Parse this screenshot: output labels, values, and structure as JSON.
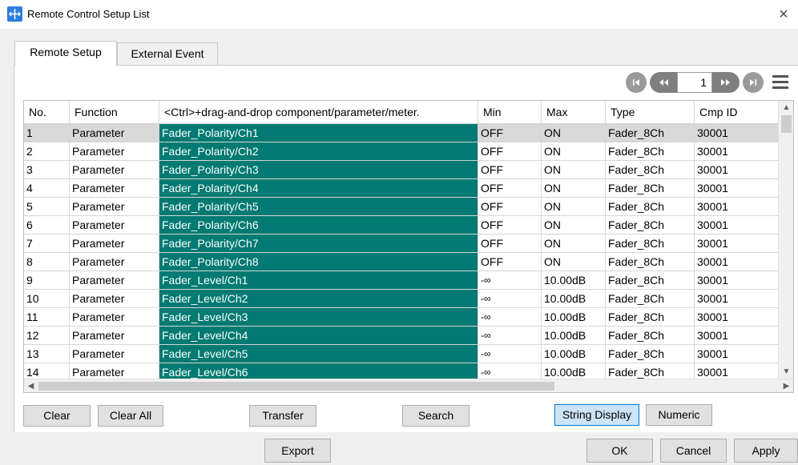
{
  "window": {
    "title": "Remote Control Setup List",
    "close_glyph": "×"
  },
  "tabs": [
    {
      "label": "Remote Setup",
      "active": true
    },
    {
      "label": "External Event",
      "active": false
    }
  ],
  "pager": {
    "first_glyph": "◀|",
    "prev_glyph": "◀◀",
    "page": "1",
    "next_glyph": "▶▶",
    "last_glyph": "▶|"
  },
  "table": {
    "columns": {
      "no": "No.",
      "function": "Function",
      "target": "<Ctrl>+drag-and-drop component/parameter/meter.",
      "min": "Min",
      "max": "Max",
      "type": "Type",
      "cmp_id": "Cmp ID"
    },
    "rows": [
      {
        "no": "1",
        "function": "Parameter",
        "target": "Fader_Polarity/Ch1",
        "min": "OFF",
        "max": "ON",
        "type": "Fader_8Ch",
        "cmp_id": "30001"
      },
      {
        "no": "2",
        "function": "Parameter",
        "target": "Fader_Polarity/Ch2",
        "min": "OFF",
        "max": "ON",
        "type": "Fader_8Ch",
        "cmp_id": "30001"
      },
      {
        "no": "3",
        "function": "Parameter",
        "target": "Fader_Polarity/Ch3",
        "min": "OFF",
        "max": "ON",
        "type": "Fader_8Ch",
        "cmp_id": "30001"
      },
      {
        "no": "4",
        "function": "Parameter",
        "target": "Fader_Polarity/Ch4",
        "min": "OFF",
        "max": "ON",
        "type": "Fader_8Ch",
        "cmp_id": "30001"
      },
      {
        "no": "5",
        "function": "Parameter",
        "target": "Fader_Polarity/Ch5",
        "min": "OFF",
        "max": "ON",
        "type": "Fader_8Ch",
        "cmp_id": "30001"
      },
      {
        "no": "6",
        "function": "Parameter",
        "target": "Fader_Polarity/Ch6",
        "min": "OFF",
        "max": "ON",
        "type": "Fader_8Ch",
        "cmp_id": "30001"
      },
      {
        "no": "7",
        "function": "Parameter",
        "target": "Fader_Polarity/Ch7",
        "min": "OFF",
        "max": "ON",
        "type": "Fader_8Ch",
        "cmp_id": "30001"
      },
      {
        "no": "8",
        "function": "Parameter",
        "target": "Fader_Polarity/Ch8",
        "min": "OFF",
        "max": "ON",
        "type": "Fader_8Ch",
        "cmp_id": "30001"
      },
      {
        "no": "9",
        "function": "Parameter",
        "target": "Fader_Level/Ch1",
        "min": "-∞",
        "max": "10.00dB",
        "type": "Fader_8Ch",
        "cmp_id": "30001"
      },
      {
        "no": "10",
        "function": "Parameter",
        "target": "Fader_Level/Ch2",
        "min": "-∞",
        "max": "10.00dB",
        "type": "Fader_8Ch",
        "cmp_id": "30001"
      },
      {
        "no": "11",
        "function": "Parameter",
        "target": "Fader_Level/Ch3",
        "min": "-∞",
        "max": "10.00dB",
        "type": "Fader_8Ch",
        "cmp_id": "30001"
      },
      {
        "no": "12",
        "function": "Parameter",
        "target": "Fader_Level/Ch4",
        "min": "-∞",
        "max": "10.00dB",
        "type": "Fader_8Ch",
        "cmp_id": "30001"
      },
      {
        "no": "13",
        "function": "Parameter",
        "target": "Fader_Level/Ch5",
        "min": "-∞",
        "max": "10.00dB",
        "type": "Fader_8Ch",
        "cmp_id": "30001"
      },
      {
        "no": "14",
        "function": "Parameter",
        "target": "Fader_Level/Ch6",
        "min": "-∞",
        "max": "10.00dB",
        "type": "Fader_8Ch",
        "cmp_id": "30001"
      }
    ]
  },
  "actions": {
    "clear": "Clear",
    "clear_all": "Clear All",
    "transfer": "Transfer",
    "search": "Search",
    "string_display": "String Display",
    "numeric": "Numeric"
  },
  "dialog": {
    "export": "Export",
    "ok": "OK",
    "cancel": "Cancel",
    "apply": "Apply"
  },
  "colors": {
    "target_cell_bg": "#007a72",
    "selected_row_bg": "#d9d9d9",
    "app_icon": "#2b7de0"
  }
}
